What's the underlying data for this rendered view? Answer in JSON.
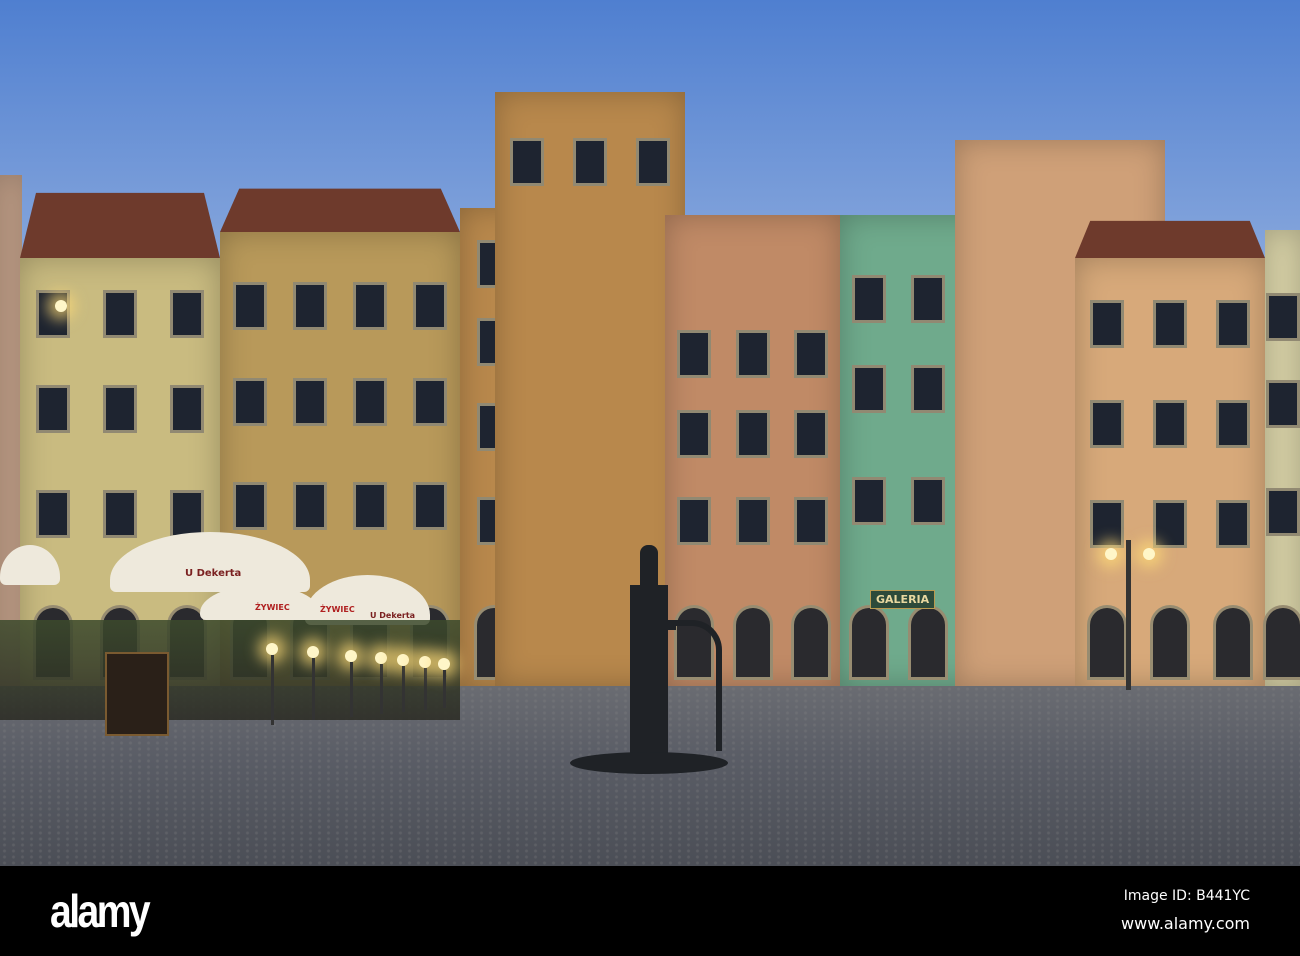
{
  "photo": {
    "colors": {
      "sky": "#86a6dc",
      "building_cream": "#c9bb80",
      "building_ochre": "#b8995a",
      "building_orange": "#b8884c",
      "building_salmon": "#c08a66",
      "building_green": "#6faa8c",
      "building_peach": "#d7a97a",
      "roof": "#6e3a2c",
      "cobblestone": "#5a5d66"
    },
    "signs": {
      "umbrella_1": "U Dekerta",
      "umbrella_2": "ŻYWIEC",
      "umbrella_3": "ŻYWIEC",
      "umbrella_4": "U Dekerta",
      "gallery": "GALERIA"
    }
  },
  "footer": {
    "logo": "alamy",
    "image_id": "Image ID: B441YC",
    "website": "www.alamy.com"
  }
}
